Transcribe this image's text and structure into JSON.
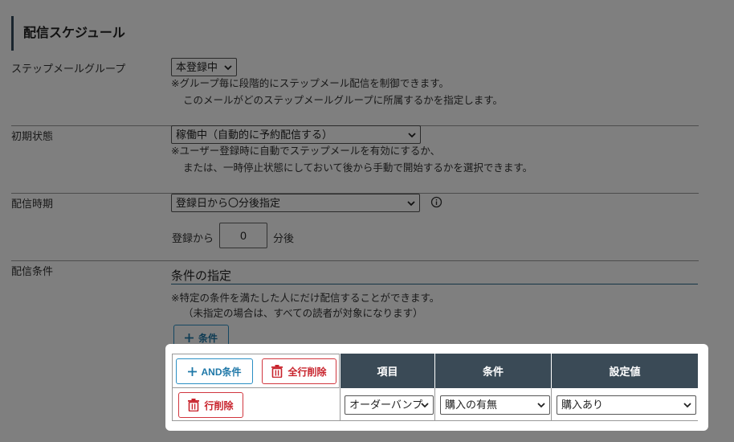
{
  "page": {
    "section_title": "配信スケジュール"
  },
  "group": {
    "label": "ステップメールグループ",
    "value": "本登録中",
    "note1": "※グループ毎に段階的にステップメール配信を制御できます。",
    "note2": "このメールがどのステップメールグループに所属するかを指定します。"
  },
  "initial": {
    "label": "初期状態",
    "value": "稼働中（自動的に予約配信する）",
    "note1": "※ユーザー登録時に自動でステップメールを有効にするか、",
    "note2": "または、一時停止状態にしておいて後から手動で開始するかを選択できます。"
  },
  "timing": {
    "label": "配信時期",
    "value": "登録日から〇分後指定",
    "prefix": "登録から",
    "minutes": "0",
    "suffix": "分後"
  },
  "condition": {
    "label": "配信条件",
    "heading": "条件の指定",
    "note1": "※特定の条件を満たした人にだけ配信することができます。",
    "note2": "（未指定の場合は、すべての読者が対象になります）",
    "add_button": "条件"
  },
  "table": {
    "and_button": "AND条件",
    "clear_all_button": "全行削除",
    "headers": [
      "項目",
      "条件",
      "設定値"
    ],
    "row": {
      "delete_button": "行削除",
      "item": "オーダーバンプ",
      "cond": "購入の有無",
      "value": "購入あり"
    }
  },
  "colors": {
    "accent_blue": "#2a8fc4",
    "danger_red": "#d1363e",
    "header_dark": "#3a4a56",
    "overlay": "rgba(0,0,0,0.5)"
  }
}
